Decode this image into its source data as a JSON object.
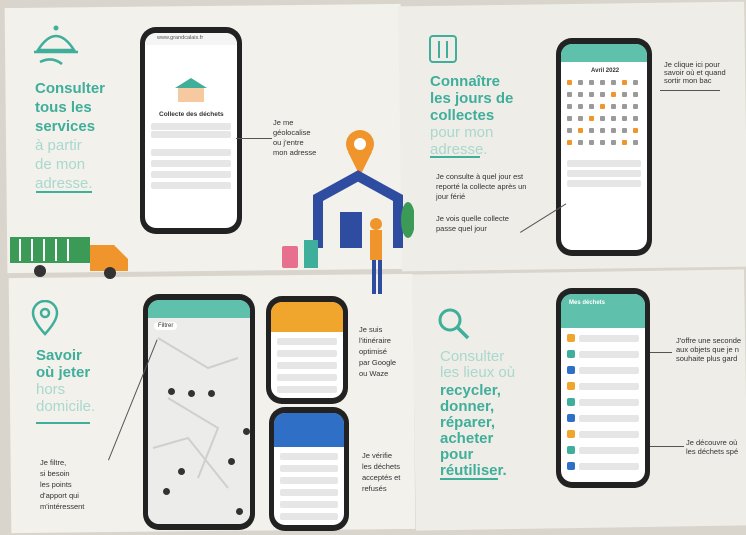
{
  "panel1": {
    "heading_lines": [
      "Consulter",
      "tous les",
      "services"
    ],
    "light_lines": [
      "à partir",
      "de mon",
      "adresse."
    ],
    "callout_lines": [
      "Je me",
      "géolocalise",
      "ou j'entre",
      "mon adresse"
    ],
    "phone_title": "Collecte des déchets",
    "phone_url": "www.grandcalais.fr"
  },
  "panel2": {
    "heading_lines": [
      "Connaître",
      "les jours de",
      "collectes"
    ],
    "light_lines": [
      "pour mon",
      "adresse."
    ],
    "callout_top_lines": [
      "Je clique ici pour",
      "savoir où et quand",
      "sortir mon bac"
    ],
    "callout_mid_lines": [
      "Je consulte à quel jour est",
      "reporté la collecte après un",
      "jour férié"
    ],
    "callout_bottom_lines": [
      "Je vois quelle collecte",
      "passe quel jour"
    ],
    "phone_month": "Avril 2022"
  },
  "panel3": {
    "heading_lines": [
      "Savoir",
      "où jeter"
    ],
    "light_lines": [
      "hors",
      "domicile."
    ],
    "callout_filter_lines": [
      "Je filtre,",
      "si besoin",
      "les points",
      "d'apport qui",
      "m'intéressent"
    ],
    "callout_route_lines": [
      "Je suis",
      "l'itinéraire",
      "optimisé",
      "par Google",
      "ou Waze"
    ],
    "callout_check_lines": [
      "Je vérifie",
      "les déchets",
      "acceptés et",
      "refusés"
    ],
    "filter_chip": "Filtrer"
  },
  "panel4": {
    "light_lines": [
      "Consulter",
      "les lieux où"
    ],
    "heading_lines": [
      "recycler,",
      "donner,",
      "réparer,",
      "acheter",
      "pour",
      "réutiliser."
    ],
    "callout_top_lines": [
      "J'offre une seconde",
      "aux objets que je n",
      "souhaite plus gard"
    ],
    "callout_bottom_lines": [
      "Je découvre où",
      "les déchets spé"
    ],
    "phone_title": "Mes déchets"
  },
  "colors": {
    "accent": "#3fae9a",
    "accent_light": "#a9d8ce",
    "orange": "#f0952c",
    "navy": "#2f4da0",
    "paper": "#f3f1ec"
  },
  "icons": [
    "cloche-icon",
    "poubelles-icon",
    "pin-icon",
    "loupe-icon",
    "camion-icon",
    "maison-icon"
  ]
}
